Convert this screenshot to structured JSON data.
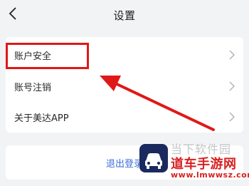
{
  "header": {
    "title": "设置",
    "back_icon": "chevron-left-icon"
  },
  "settings": {
    "items": [
      {
        "label": "账户安全",
        "icon": "chevron-right-icon"
      },
      {
        "label": "账号注销",
        "icon": "chevron-right-icon"
      },
      {
        "label": "关于美达APP",
        "icon": "chevron-right-icon"
      }
    ]
  },
  "logout": {
    "label": "退出登录"
  },
  "annotation": {
    "highlight_color": "#e01818",
    "arrow_color": "#e01818"
  },
  "watermark": {
    "line1": "当下软件园",
    "line2": "道车手游网",
    "line3": "www.lmwwsz.com"
  },
  "colors": {
    "background": "#f2f3f5",
    "card": "#ffffff",
    "link": "#3b6fd6"
  }
}
